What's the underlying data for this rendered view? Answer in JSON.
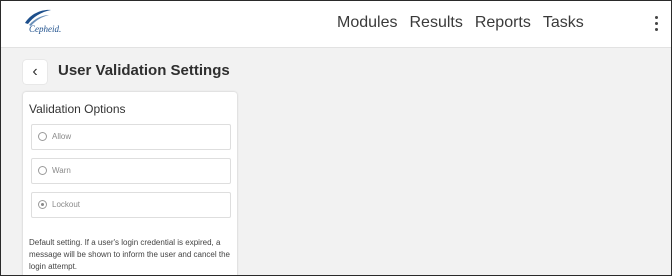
{
  "brand": {
    "logo_text": "Cepheid."
  },
  "nav": {
    "items": [
      "Modules",
      "Results",
      "Reports",
      "Tasks"
    ]
  },
  "page": {
    "title": "User Validation Settings"
  },
  "card": {
    "title": "Validation Options",
    "options": [
      {
        "label": "Allow",
        "selected": false
      },
      {
        "label": "Warn",
        "selected": false
      },
      {
        "label": "Lockout",
        "selected": true
      }
    ],
    "description": "Default setting. If a user's login credential is expired, a message will be shown to inform the user and cancel the login attempt."
  },
  "colors": {
    "brand": "#1d4f8c",
    "background": "#f2f2f2"
  }
}
